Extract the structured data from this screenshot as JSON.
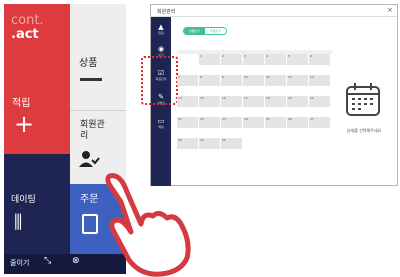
{
  "phone": {
    "logo_line1": "cont.",
    "logo_line2": ".act",
    "tile_acquire": "적립",
    "tile_goods": "상품",
    "tile_member": "회원관리",
    "tile_dating": "데이팅",
    "tile_order": "주문",
    "bottom_unfold": "줄이기",
    "colors": {
      "red": "#dd3b3f",
      "navy": "#1e2553",
      "blue": "#3e61c1",
      "gray": "#eeeeee"
    }
  },
  "window": {
    "title": "회원관리",
    "close": "×",
    "toggle_on": "월별보기",
    "toggle_off": "주별보기",
    "sidebar": [
      {
        "icon": "bell-icon",
        "label": "알림"
      },
      {
        "icon": "eye-icon",
        "label": "보기"
      },
      {
        "icon": "check-icon",
        "label": "회원관리"
      },
      {
        "icon": "edit-icon",
        "label": "이벤트"
      },
      {
        "icon": "chat-icon",
        "label": "채팅"
      }
    ],
    "calendar": {
      "weeks": [
        [
          "",
          "1",
          "2",
          "3",
          "4",
          "5",
          "6"
        ],
        [
          "7",
          "8",
          "9",
          "10",
          "11",
          "12",
          "13"
        ],
        [
          "14",
          "15",
          "16",
          "17",
          "18",
          "19",
          "20"
        ],
        [
          "21",
          "22",
          "23",
          "24",
          "25",
          "26",
          "27"
        ],
        [
          "28",
          "29",
          "30",
          "",
          "",
          "",
          ""
        ]
      ]
    },
    "detail_text": "상세를 선택해주세요",
    "accent": "#3fbf9a"
  }
}
